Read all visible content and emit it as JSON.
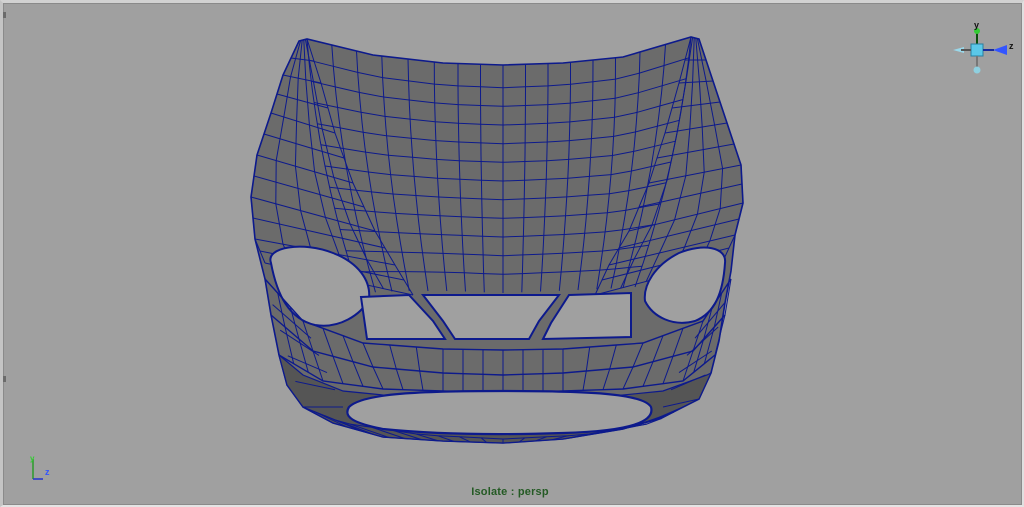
{
  "viewport": {
    "camera_label": "Isolate : persp",
    "background": "#a0a0a0",
    "mesh": {
      "object": "car-hood-and-front-bumper",
      "fill": "#6b6b6b",
      "fill_dark": "#555555",
      "wire_color": "#0d1a8c"
    }
  },
  "view_cube": {
    "y_label": "y",
    "z_label": "z",
    "x_color": "#ff3333",
    "y_color": "#33cc33",
    "z_color": "#3355ff",
    "face_color": "#5bc8e8"
  },
  "axis_indicator": {
    "y_label": "y",
    "z_label": "z",
    "y_color": "#33cc33",
    "z_color": "#3355ff"
  }
}
